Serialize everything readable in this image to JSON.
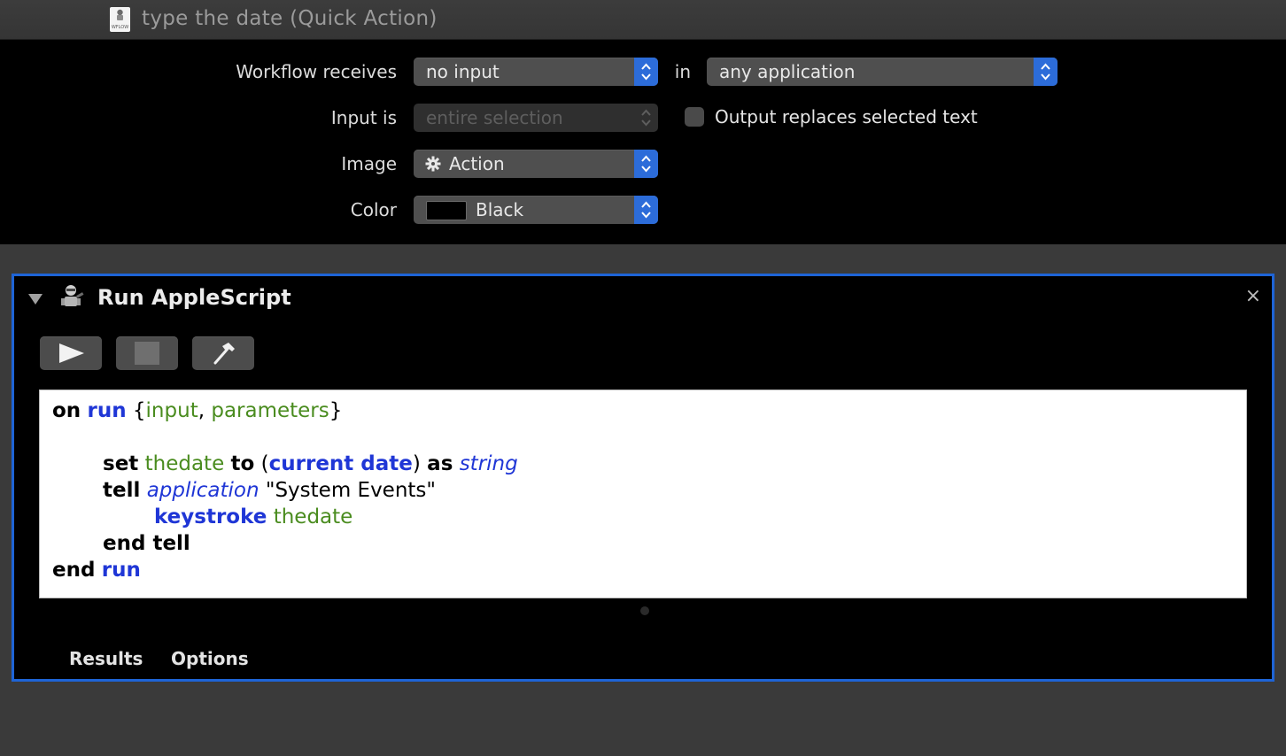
{
  "window": {
    "title": "type the date (Quick Action)",
    "doc_icon": "workflow-document-icon"
  },
  "settings": {
    "workflow_receives_label": "Workflow receives",
    "workflow_receives_value": "no input",
    "in_label": "in",
    "application_value": "any application",
    "input_is_label": "Input is",
    "input_is_value": "entire selection",
    "output_replaces_label": "Output replaces selected text",
    "output_replaces_checked": false,
    "image_label": "Image",
    "image_value": "Action",
    "color_label": "Color",
    "color_value": "Black",
    "color_swatch": "#000000"
  },
  "action": {
    "title": "Run AppleScript",
    "close_glyph": "×",
    "toolbar": {
      "run": "play-icon",
      "stop": "stop-icon",
      "compile": "hammer-icon"
    },
    "script": {
      "l1_on": "on",
      "l1_run": "run",
      "l1_brace_open": "{",
      "l1_input": "input",
      "l1_comma": ", ",
      "l1_parameters": "parameters",
      "l1_brace_close": "}",
      "l3_set": "set",
      "l3_thedate": "thedate",
      "l3_to": "to",
      "l3_paren_open": "(",
      "l3_current_date": "current date",
      "l3_paren_close": ")",
      "l3_as": "as",
      "l3_string": "string",
      "l4_tell": "tell",
      "l4_application": "application",
      "l4_string": "\"System Events\"",
      "l5_keystroke": "keystroke",
      "l5_thedate": "thedate",
      "l6_end_tell": "end tell",
      "l7_end": "end",
      "l7_run": "run"
    },
    "tabs": {
      "results": "Results",
      "options": "Options"
    }
  },
  "colors": {
    "accent": "#2c6cd9",
    "panel_border": "#1e64d6",
    "keyword_blue": "#1f36d6",
    "variable_green": "#4a8c1f"
  }
}
